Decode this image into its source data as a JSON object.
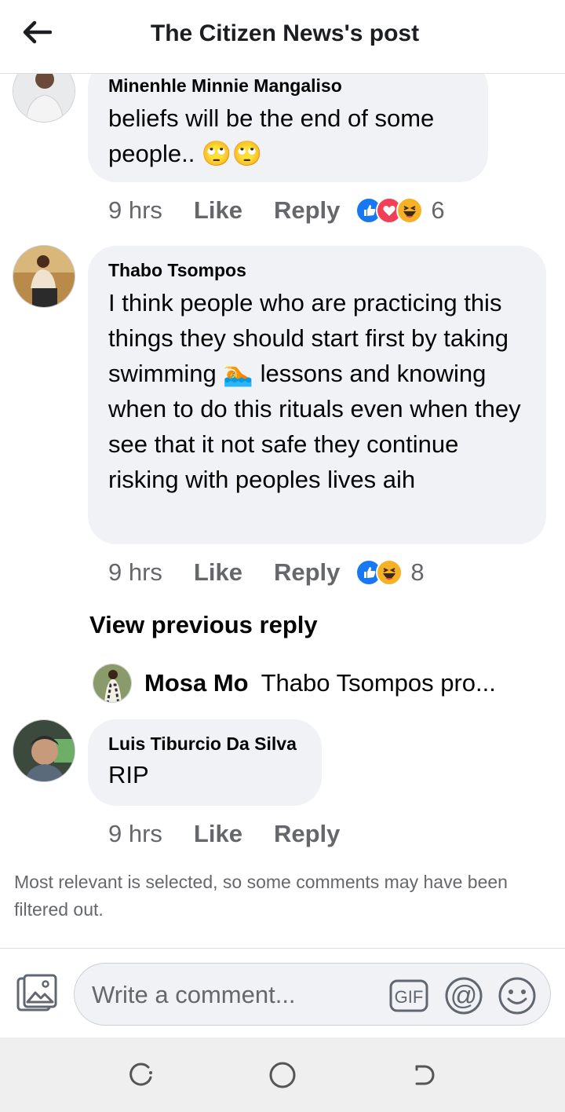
{
  "header": {
    "title": "The Citizen News's post",
    "back_icon": "arrow-left-icon"
  },
  "comments": [
    {
      "author": "Minenhle Minnie Mangaliso",
      "text": "beliefs will be the end of some people.. 🙄🙄",
      "time": "9 hrs",
      "like_label": "Like",
      "reply_label": "Reply",
      "reactions": [
        "like",
        "love",
        "haha"
      ],
      "reaction_count": "6"
    },
    {
      "author": "Thabo Tsompos",
      "text": "I think people who are practicing this things they should start first by taking swimming 🏊 lessons and knowing when to do this rituals even when they see that it not safe they continue risking with peoples lives aih",
      "time": "9 hrs",
      "like_label": "Like",
      "reply_label": "Reply",
      "reactions": [
        "like",
        "haha"
      ],
      "reaction_count": "8"
    },
    {
      "author": "Luis Tiburcio Da Silva",
      "text": "RIP",
      "time": "9 hrs",
      "like_label": "Like",
      "reply_label": "Reply"
    }
  ],
  "replies": {
    "view_previous_label": "View previous reply",
    "latest_reply_author": "Mosa Mo",
    "latest_reply_preview": "Thabo Tsompos pro..."
  },
  "filter_note": "Most relevant is selected, so some comments may have been filtered out.",
  "composer": {
    "placeholder": "Write a comment...",
    "gif_label": "GIF",
    "mention_label": "@"
  },
  "colors": {
    "like_blue": "#1877f2",
    "love_red": "#f33e58",
    "haha_yellow": "#f7b125",
    "bubble_gray": "#f0f2f5",
    "meta_gray": "#65676b"
  }
}
